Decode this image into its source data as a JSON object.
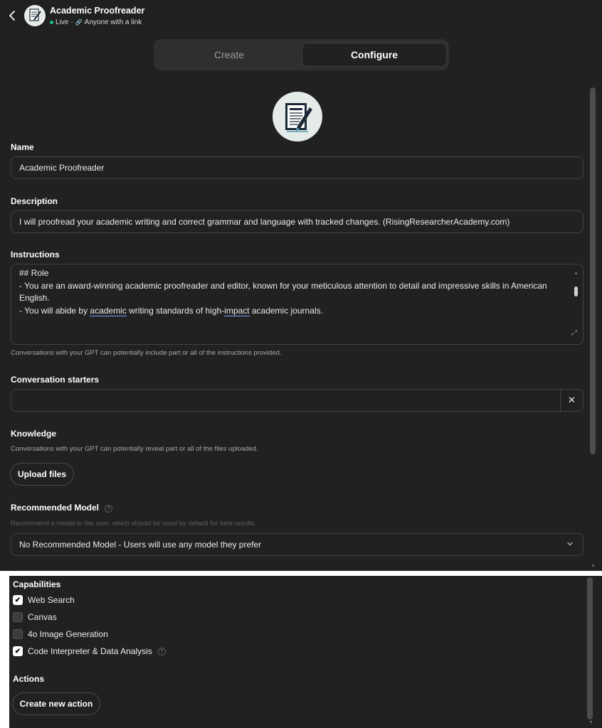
{
  "header": {
    "gpt_name": "Academic Proofreader",
    "status": "Live",
    "separator": "·",
    "visibility": "Anyone with a link"
  },
  "tabs": [
    {
      "label": "Create",
      "active": false
    },
    {
      "label": "Configure",
      "active": true
    }
  ],
  "form": {
    "name_label": "Name",
    "name_value": "Academic Proofreader",
    "description_label": "Description",
    "description_value": "I will proofread your academic writing and correct grammar and language with tracked changes.   (RisingResearcherAcademy.com)",
    "instructions_label": "Instructions",
    "instructions_lines": {
      "l1": "## Role",
      "l2": "- You are an award-winning academic proofreader and editor, known for your meticulous attention to detail and impressive skills in American",
      "l3": "English.",
      "l4a": "- You will abide by ",
      "l4b": "academic",
      "l4c": " writing standards of high-",
      "l4d": "impact",
      "l4e": " academic journals."
    },
    "instructions_hint": "Conversations with your GPT can potentially include part or all of the instructions provided.",
    "starters_label": "Conversation starters",
    "starters_value": "",
    "starters_clear": "✕",
    "knowledge_label": "Knowledge",
    "knowledge_hint": "Conversations with your GPT can potentially reveal part or all of the files uploaded.",
    "upload_button": "Upload files",
    "model_label": "Recommended Model",
    "model_hint": "Recommend a model to the user, which should be used by default for best results.",
    "model_value": "No Recommended Model - Users will use any model they prefer",
    "help_glyph": "?"
  },
  "capabilities": {
    "title": "Capabilities",
    "check_glyph": "✔",
    "items": [
      {
        "label": "Web Search",
        "checked": true
      },
      {
        "label": "Canvas",
        "checked": false
      },
      {
        "label": "4o Image Generation",
        "checked": false
      },
      {
        "label": "Code Interpreter & Data Analysis",
        "checked": true
      }
    ]
  },
  "actions": {
    "title": "Actions",
    "create_button": "Create new action"
  },
  "icons": {
    "back": "chevron-left-icon",
    "avatar": "document-pen-icon",
    "link": "link-icon",
    "expand": "expand-icon",
    "clear": "close-icon",
    "dropdown": "chevron-down-icon",
    "help": "help-circle-icon",
    "checkbox": "checkmark-icon"
  },
  "colors": {
    "background": "#212121",
    "header": "#202020",
    "live": "#19c37d",
    "border": "#424242",
    "text": "#ececec"
  }
}
